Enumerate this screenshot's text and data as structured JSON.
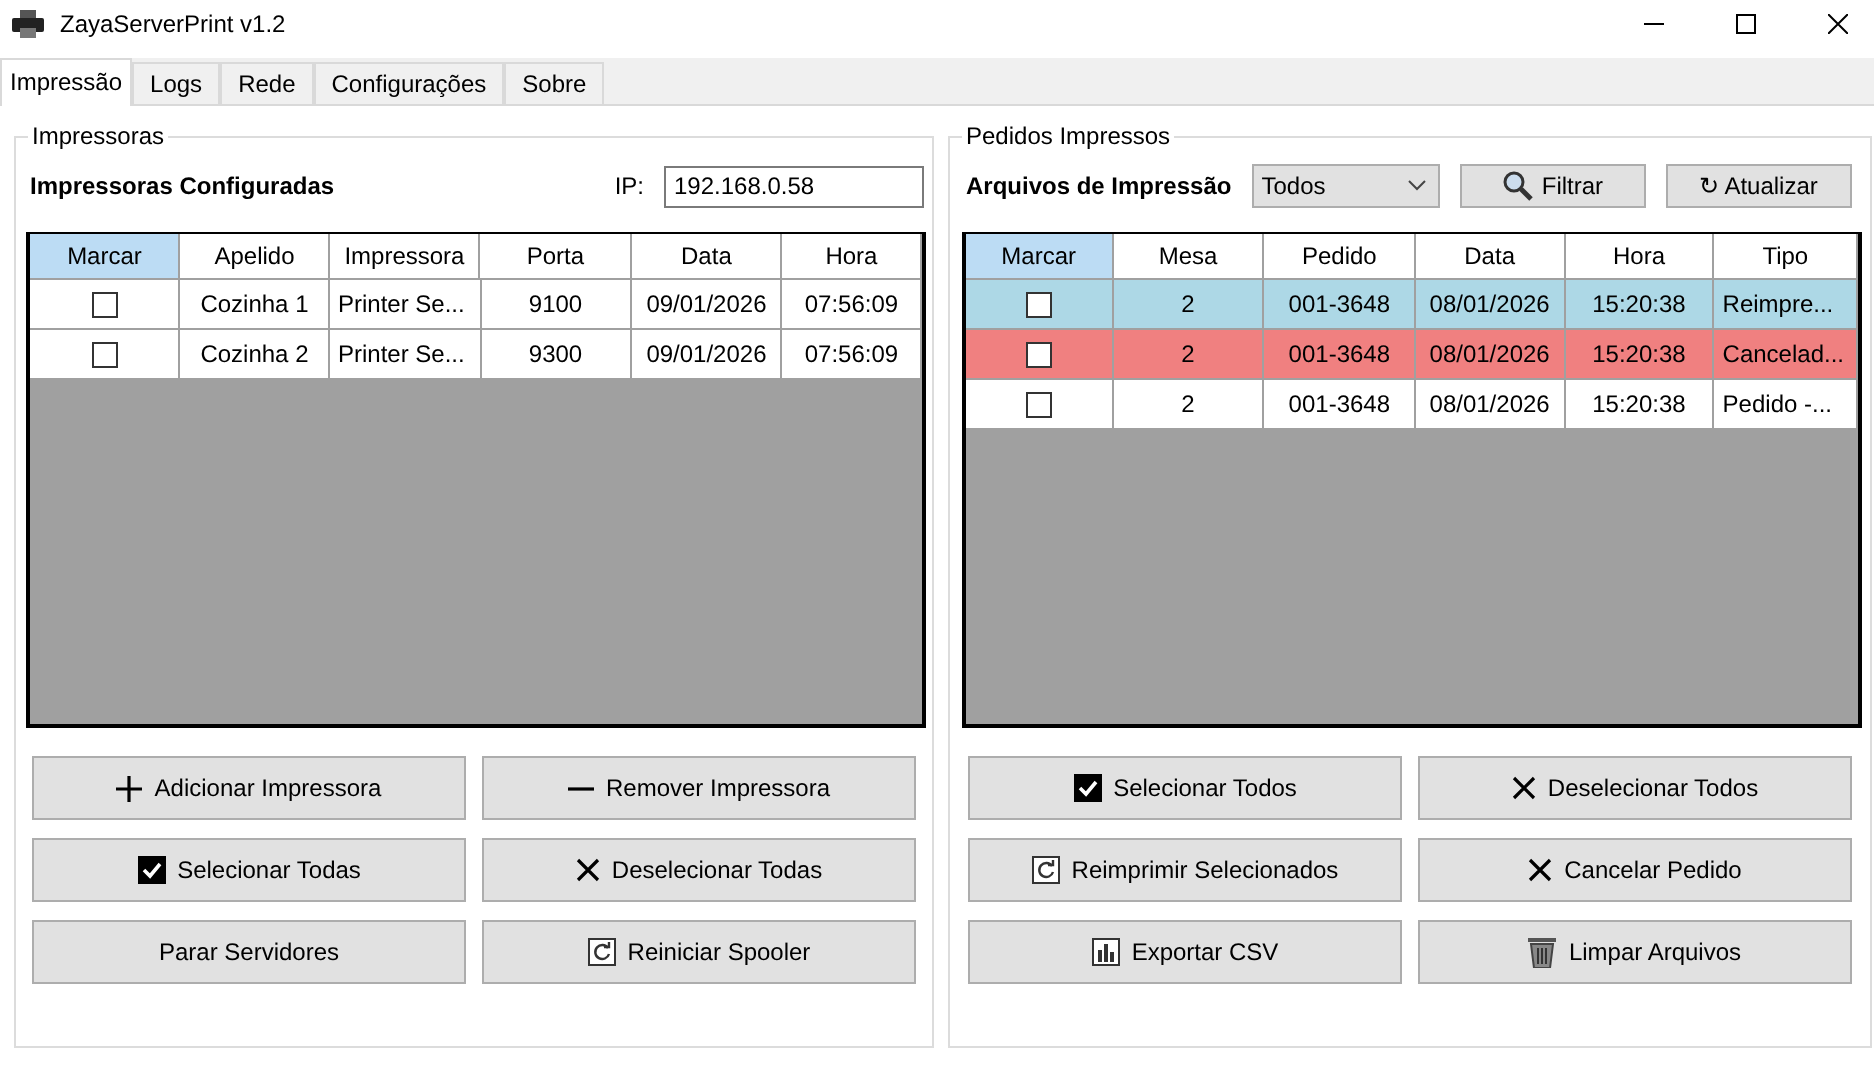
{
  "window": {
    "title": "ZayaServerPrint v1.2"
  },
  "tabs": [
    {
      "label": "Impressão",
      "selected": true
    },
    {
      "label": "Logs",
      "selected": false
    },
    {
      "label": "Rede",
      "selected": false
    },
    {
      "label": "Configurações",
      "selected": false
    },
    {
      "label": "Sobre",
      "selected": false
    }
  ],
  "printers_group": {
    "title": "Impressoras",
    "heading": "Impressoras Configuradas",
    "ip_label": "IP:",
    "ip_value": "192.168.0.58",
    "table": {
      "columns": [
        {
          "label": "Marcar",
          "selected": true
        },
        {
          "label": "Apelido",
          "selected": false
        },
        {
          "label": "Impressora",
          "selected": false
        },
        {
          "label": "Porta",
          "selected": false
        },
        {
          "label": "Data",
          "selected": false
        },
        {
          "label": "Hora",
          "selected": false
        }
      ],
      "rows": [
        {
          "color": "#ffffff",
          "cells": [
            {
              "kind": "checkbox",
              "checked": false
            },
            {
              "kind": "text",
              "text": "Cozinha 1"
            },
            {
              "kind": "text",
              "text": "Printer Se..."
            },
            {
              "kind": "text",
              "text": "9100"
            },
            {
              "kind": "text",
              "text": "09/01/2026"
            },
            {
              "kind": "text",
              "text": "07:56:09"
            }
          ]
        },
        {
          "color": "#ffffff",
          "cells": [
            {
              "kind": "checkbox",
              "checked": false
            },
            {
              "kind": "text",
              "text": "Cozinha 2"
            },
            {
              "kind": "text",
              "text": "Printer Se..."
            },
            {
              "kind": "text",
              "text": "9300"
            },
            {
              "kind": "text",
              "text": "09/01/2026"
            },
            {
              "kind": "text",
              "text": "07:56:09"
            }
          ]
        }
      ]
    },
    "buttons": [
      {
        "label": "Adicionar Impressora",
        "kind": "plus"
      },
      {
        "label": "Remover Impressora",
        "kind": "minus"
      },
      {
        "label": "Selecionar Todas",
        "kind": "check"
      },
      {
        "label": "Deselecionar Todas",
        "kind": "x"
      },
      {
        "label": "Parar Servidores",
        "kind": "plain"
      },
      {
        "label": "Reiniciar Spooler",
        "kind": "refresh"
      }
    ]
  },
  "orders_group": {
    "title": "Pedidos Impressos",
    "heading": "Arquivos de Impressão",
    "filter_value": "Todos",
    "filter_button": "Filtrar",
    "refresh_button": "↻ Atualizar",
    "table": {
      "columns": [
        {
          "label": "Marcar",
          "selected": true
        },
        {
          "label": "Mesa",
          "selected": false
        },
        {
          "label": "Pedido",
          "selected": false
        },
        {
          "label": "Data",
          "selected": false
        },
        {
          "label": "Hora",
          "selected": false
        },
        {
          "label": "Tipo",
          "selected": false
        }
      ],
      "rows": [
        {
          "color": "#add8e6",
          "cells": [
            {
              "kind": "checkbox",
              "checked": false
            },
            {
              "kind": "text",
              "text": "2"
            },
            {
              "kind": "text",
              "text": "001-3648"
            },
            {
              "kind": "text",
              "text": "08/01/2026"
            },
            {
              "kind": "text",
              "text": "15:20:38"
            },
            {
              "kind": "text",
              "text": "Reimpre..."
            }
          ]
        },
        {
          "color": "#f08080",
          "cells": [
            {
              "kind": "checkbox",
              "checked": false
            },
            {
              "kind": "text",
              "text": "2"
            },
            {
              "kind": "text",
              "text": "001-3648"
            },
            {
              "kind": "text",
              "text": "08/01/2026"
            },
            {
              "kind": "text",
              "text": "15:20:38"
            },
            {
              "kind": "text",
              "text": "Cancelad..."
            }
          ]
        },
        {
          "color": "#ffffff",
          "cells": [
            {
              "kind": "checkbox",
              "checked": false
            },
            {
              "kind": "text",
              "text": "2"
            },
            {
              "kind": "text",
              "text": "001-3648"
            },
            {
              "kind": "text",
              "text": "08/01/2026"
            },
            {
              "kind": "text",
              "text": "15:20:38"
            },
            {
              "kind": "text",
              "text": "Pedido -..."
            }
          ]
        }
      ]
    },
    "buttons": [
      {
        "label": "Selecionar Todos",
        "kind": "check"
      },
      {
        "label": "Deselecionar Todos",
        "kind": "x"
      },
      {
        "label": "Reimprimir Selecionados",
        "kind": "refresh"
      },
      {
        "label": "Cancelar Pedido",
        "kind": "x"
      },
      {
        "label": "Exportar CSV",
        "kind": "chart"
      },
      {
        "label": "Limpar Arquivos",
        "kind": "trash"
      }
    ]
  }
}
